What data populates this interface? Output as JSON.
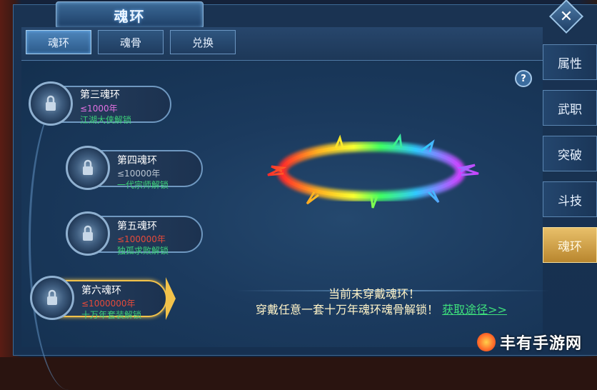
{
  "window": {
    "title": "魂环"
  },
  "top_tabs": [
    {
      "label": "魂环",
      "active": true
    },
    {
      "label": "魂骨",
      "active": false
    },
    {
      "label": "兑换",
      "active": false
    }
  ],
  "side_tabs": [
    {
      "label": "属性",
      "active": false
    },
    {
      "label": "武职",
      "active": false
    },
    {
      "label": "突破",
      "active": false
    },
    {
      "label": "斗技",
      "active": false
    },
    {
      "label": "魂环",
      "active": true
    }
  ],
  "help_label": "?",
  "close_label": "✕",
  "rings": [
    {
      "name": "第三魂环",
      "age": "≤1000年",
      "age_color": "#e070e0",
      "unlock": "江湖大侠解锁",
      "active": false
    },
    {
      "name": "第四魂环",
      "age": "≤10000年",
      "age_color": "#b9c4d0",
      "unlock": "一代宗师解锁",
      "active": false
    },
    {
      "name": "第五魂环",
      "age": "≤100000年",
      "age_color": "#e64a3a",
      "unlock": "独孤求败解锁",
      "active": false
    },
    {
      "name": "第六魂环",
      "age": "≤1000000年",
      "age_color": "#e64a3a",
      "unlock": "十万年套装解锁",
      "active": true
    }
  ],
  "message": {
    "line1": "当前未穿戴魂环！",
    "line2": "穿戴任意一套十万年魂环魂骨解锁！",
    "link": "获取途径>>"
  },
  "watermark": {
    "text": "丰有手游网"
  },
  "colors": {
    "accent_gold": "#f2c24a",
    "link_green": "#3ee07c"
  }
}
